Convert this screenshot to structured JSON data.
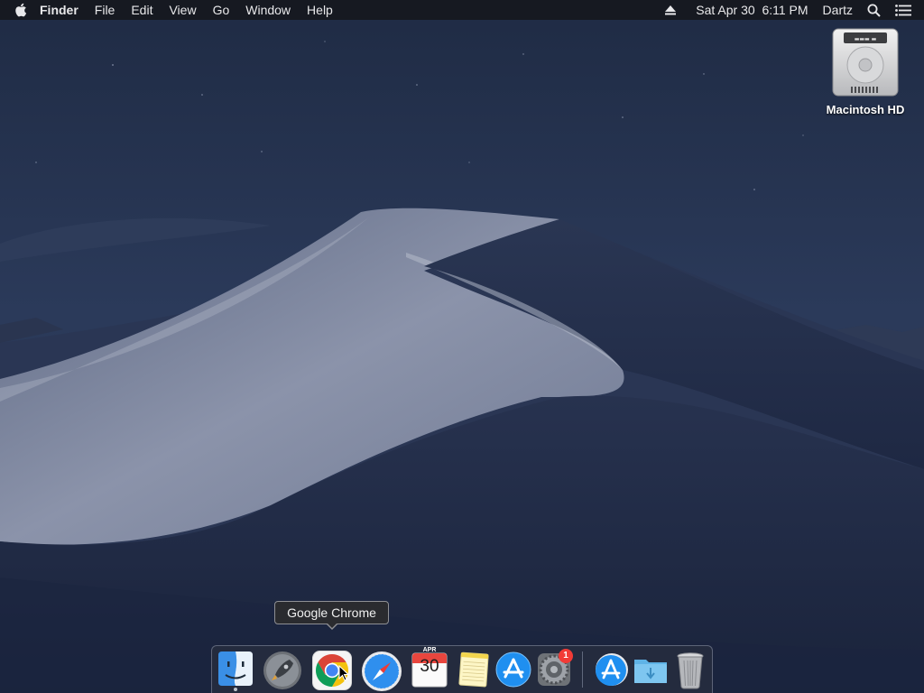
{
  "menubar": {
    "app_name": "Finder",
    "menus": [
      "File",
      "Edit",
      "View",
      "Go",
      "Window",
      "Help"
    ],
    "datetime": "Sat Apr 30  6:11 PM",
    "user": "Dartz",
    "icons": [
      "apple-icon",
      "eject-icon",
      "spotlight-icon",
      "notification-center-icon"
    ]
  },
  "desktop": {
    "hd_label": "Macintosh HD"
  },
  "tooltip": {
    "text": "Google Chrome"
  },
  "dock": {
    "apps": [
      {
        "name": "Finder",
        "icon": "finder-icon",
        "running": true
      },
      {
        "name": "Launchpad",
        "icon": "launchpad-icon",
        "running": false
      },
      {
        "name": "Google Chrome",
        "icon": "chrome-icon",
        "running": false
      },
      {
        "name": "Safari",
        "icon": "safari-icon",
        "running": false
      },
      {
        "name": "Calendar",
        "icon": "calendar-icon",
        "running": false
      },
      {
        "name": "Notes",
        "icon": "notes-icon",
        "running": false
      },
      {
        "name": "App Store",
        "icon": "app-store-icon",
        "running": false
      },
      {
        "name": "System Preferences",
        "icon": "system-preferences-icon",
        "running": false
      }
    ],
    "others": [
      {
        "name": "Applications",
        "icon": "applications-folder-icon"
      },
      {
        "name": "Downloads",
        "icon": "downloads-folder-icon"
      },
      {
        "name": "Trash",
        "icon": "trash-icon"
      }
    ],
    "calendar_month": "APR",
    "calendar_day": "30",
    "system_preferences_badge": "1"
  },
  "colors": {
    "menubar_bg": "#16181e",
    "dock_bg": "#282e3e",
    "badge_red": "#f23b36",
    "chrome_red": "#db4437",
    "chrome_yellow": "#f4c20d",
    "chrome_green": "#0f9d58",
    "chrome_blue": "#4285f4"
  }
}
